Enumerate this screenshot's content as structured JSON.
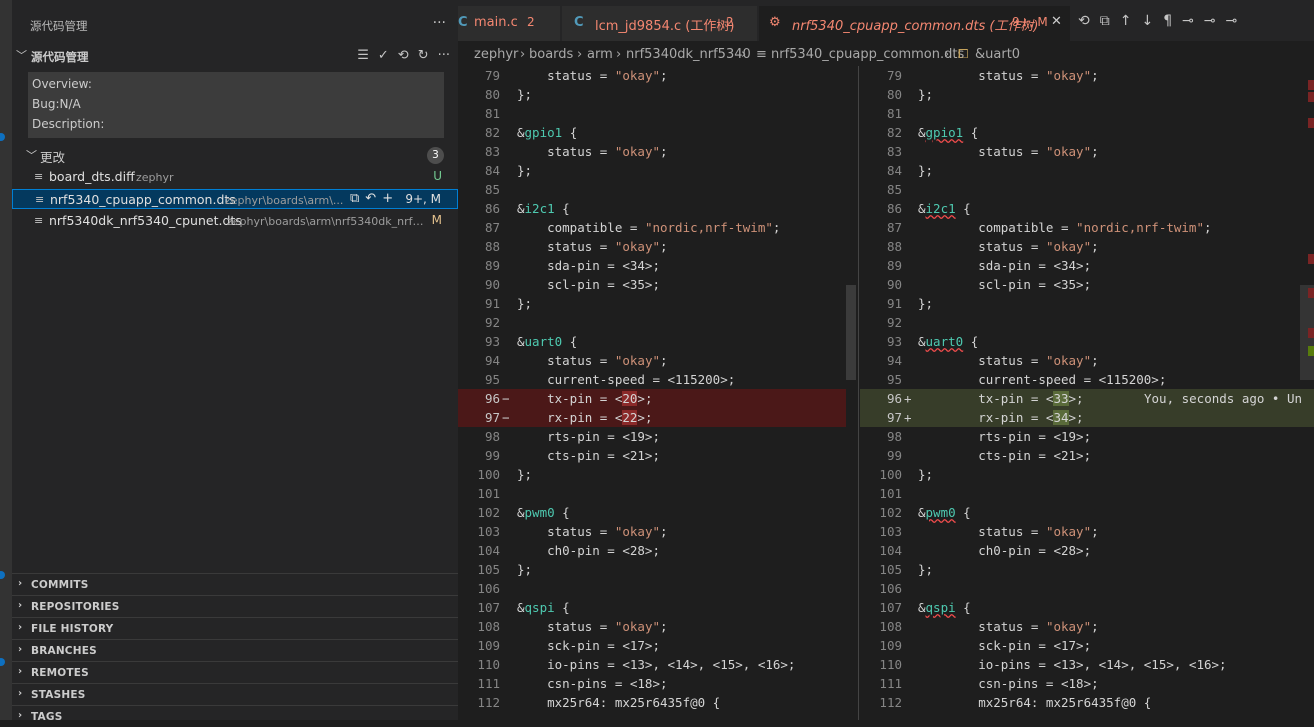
{
  "sidebar": {
    "title": "源代码管理",
    "more": "···",
    "scm_label": "源代码管理",
    "message_lines": [
      "Overview:",
      "Bug:N/A",
      "Description:"
    ],
    "changes_label": "更改",
    "changes_count": "3",
    "files": [
      {
        "name": "board_dts.diff",
        "path": "zephyr",
        "status": "U",
        "status_color": "#73c991"
      },
      {
        "name": "nrf5340_cpuapp_common.dts",
        "path": "zephyr\\boards\\arm\\...",
        "status": "9+, M",
        "status_color": "#e2c08d"
      },
      {
        "name": "nrf5340dk_nrf5340_cpunet.dts",
        "path": "zephyr\\boards\\arm\\nrf5340dk_nrf53...",
        "status": "M",
        "status_color": "#e2c08d"
      }
    ],
    "panels": [
      "COMMITS",
      "REPOSITORIES",
      "FILE HISTORY",
      "BRANCHES",
      "REMOTES",
      "STASHES",
      "TAGS"
    ]
  },
  "tabs": [
    {
      "icon": "C",
      "name": "main.c",
      "count": "2",
      "color": "#f48771"
    },
    {
      "icon": "C",
      "name": "lcm_jd9854.c (工作树)",
      "count": "2",
      "color": "#f48771"
    },
    {
      "icon": "",
      "name": "nrf5340_cpuapp_common.dts (工作树)",
      "count": "9+, M",
      "color": "#f48771"
    }
  ],
  "breadcrumb": [
    "zephyr",
    "boards",
    "arm",
    "nrf5340dk_nrf5340",
    "nrf5340_cpuapp_common.dts",
    "&uart0"
  ],
  "blame_text": "You, seconds ago • Un",
  "colors": {
    "accent": "#007fd4",
    "deleted_bg": "#4b1818",
    "added_bg": "#373d29",
    "string": "#ce9178",
    "label": "#4ec9b0"
  },
  "left_lines": [
    {
      "n": "79",
      "t": "    status = \"okay\";"
    },
    {
      "n": "80",
      "t": "};"
    },
    {
      "n": "81",
      "t": ""
    },
    {
      "n": "82",
      "t": "&gpio1 {"
    },
    {
      "n": "83",
      "t": "    status = \"okay\";"
    },
    {
      "n": "84",
      "t": "};"
    },
    {
      "n": "85",
      "t": ""
    },
    {
      "n": "86",
      "t": "&i2c1 {"
    },
    {
      "n": "87",
      "t": "    compatible = \"nordic,nrf-twim\";"
    },
    {
      "n": "88",
      "t": "    status = \"okay\";"
    },
    {
      "n": "89",
      "t": "    sda-pin = <34>;"
    },
    {
      "n": "90",
      "t": "    scl-pin = <35>;"
    },
    {
      "n": "91",
      "t": "};"
    },
    {
      "n": "92",
      "t": ""
    },
    {
      "n": "93",
      "t": "&uart0 {"
    },
    {
      "n": "94",
      "t": "    status = \"okay\";"
    },
    {
      "n": "95",
      "t": "    current-speed = <115200>;"
    },
    {
      "n": "96",
      "t": "    tx-pin = <20>;",
      "m": "−",
      "k": "del"
    },
    {
      "n": "97",
      "t": "    rx-pin = <22>;",
      "m": "−",
      "k": "del"
    },
    {
      "n": "98",
      "t": "    rts-pin = <19>;"
    },
    {
      "n": "99",
      "t": "    cts-pin = <21>;"
    },
    {
      "n": "100",
      "t": "};"
    },
    {
      "n": "101",
      "t": ""
    },
    {
      "n": "102",
      "t": "&pwm0 {"
    },
    {
      "n": "103",
      "t": "    status = \"okay\";"
    },
    {
      "n": "104",
      "t": "    ch0-pin = <28>;"
    },
    {
      "n": "105",
      "t": "};"
    },
    {
      "n": "106",
      "t": ""
    },
    {
      "n": "107",
      "t": "&qspi {"
    },
    {
      "n": "108",
      "t": "    status = \"okay\";"
    },
    {
      "n": "109",
      "t": "    sck-pin = <17>;"
    },
    {
      "n": "110",
      "t": "    io-pins = <13>, <14>, <15>, <16>;"
    },
    {
      "n": "111",
      "t": "    csn-pins = <18>;"
    },
    {
      "n": "112",
      "t": "    mx25r64: mx25r6435f@0 {"
    }
  ],
  "right_lines": [
    {
      "n": "79",
      "t": "        status = \"okay\";"
    },
    {
      "n": "80",
      "t": "};"
    },
    {
      "n": "81",
      "t": ""
    },
    {
      "n": "82",
      "t": "&gpio1 {"
    },
    {
      "n": "83",
      "t": "        status = \"okay\";"
    },
    {
      "n": "84",
      "t": "};"
    },
    {
      "n": "85",
      "t": ""
    },
    {
      "n": "86",
      "t": "&i2c1 {"
    },
    {
      "n": "87",
      "t": "        compatible = \"nordic,nrf-twim\";"
    },
    {
      "n": "88",
      "t": "        status = \"okay\";"
    },
    {
      "n": "89",
      "t": "        sda-pin = <34>;"
    },
    {
      "n": "90",
      "t": "        scl-pin = <35>;"
    },
    {
      "n": "91",
      "t": "};"
    },
    {
      "n": "92",
      "t": ""
    },
    {
      "n": "93",
      "t": "&uart0 {"
    },
    {
      "n": "94",
      "t": "        status = \"okay\";"
    },
    {
      "n": "95",
      "t": "        current-speed = <115200>;"
    },
    {
      "n": "96",
      "t": "        tx-pin = <33>;",
      "m": "+",
      "k": "add"
    },
    {
      "n": "97",
      "t": "        rx-pin = <34>;",
      "m": "+",
      "k": "add"
    },
    {
      "n": "98",
      "t": "        rts-pin = <19>;"
    },
    {
      "n": "99",
      "t": "        cts-pin = <21>;"
    },
    {
      "n": "100",
      "t": "};"
    },
    {
      "n": "101",
      "t": ""
    },
    {
      "n": "102",
      "t": "&pwm0 {"
    },
    {
      "n": "103",
      "t": "        status = \"okay\";"
    },
    {
      "n": "104",
      "t": "        ch0-pin = <28>;"
    },
    {
      "n": "105",
      "t": "};"
    },
    {
      "n": "106",
      "t": ""
    },
    {
      "n": "107",
      "t": "&qspi {"
    },
    {
      "n": "108",
      "t": "        status = \"okay\";"
    },
    {
      "n": "109",
      "t": "        sck-pin = <17>;"
    },
    {
      "n": "110",
      "t": "        io-pins = <13>, <14>, <15>, <16>;"
    },
    {
      "n": "111",
      "t": "        csn-pins = <18>;"
    },
    {
      "n": "112",
      "t": "        mx25r64: mx25r6435f@0 {"
    }
  ]
}
